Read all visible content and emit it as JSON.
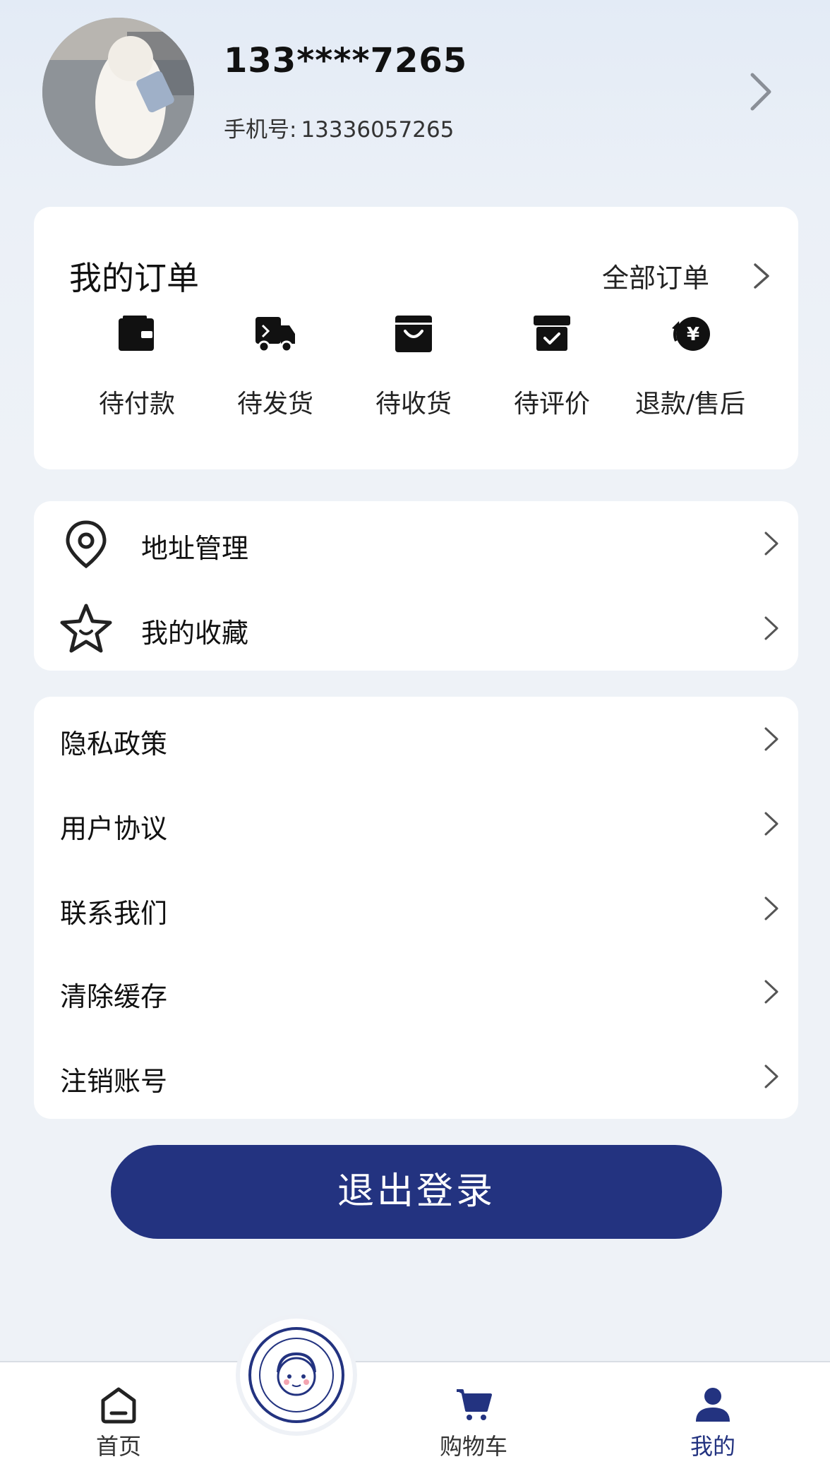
{
  "profile": {
    "name": "133****7265",
    "phone_label": "手机号:",
    "phone_value": "13336057265"
  },
  "orders": {
    "title": "我的订单",
    "all_label": "全部订单",
    "items": [
      {
        "label": "待付款",
        "icon": "wallet-icon"
      },
      {
        "label": "待发货",
        "icon": "truck-icon"
      },
      {
        "label": "待收货",
        "icon": "shopping-bag-icon"
      },
      {
        "label": "待评价",
        "icon": "review-box-icon"
      },
      {
        "label": "退款/售后",
        "icon": "refund-yen-icon"
      }
    ]
  },
  "menu1": [
    {
      "label": "地址管理",
      "icon": "location-pin-icon"
    },
    {
      "label": "我的收藏",
      "icon": "star-icon"
    }
  ],
  "menu2": [
    {
      "label": "隐私政策"
    },
    {
      "label": "用户协议"
    },
    {
      "label": "联系我们"
    },
    {
      "label": "清除缓存"
    },
    {
      "label": "注销账号"
    }
  ],
  "logout_label": "退出登录",
  "tabbar": [
    {
      "label": "首页",
      "icon": "home-icon"
    },
    {
      "label": "购物车",
      "icon": "cart-icon"
    },
    {
      "label": "我的",
      "icon": "user-icon",
      "active": true
    }
  ],
  "colors": {
    "accent": "#233380",
    "background": "#eef2f7"
  }
}
